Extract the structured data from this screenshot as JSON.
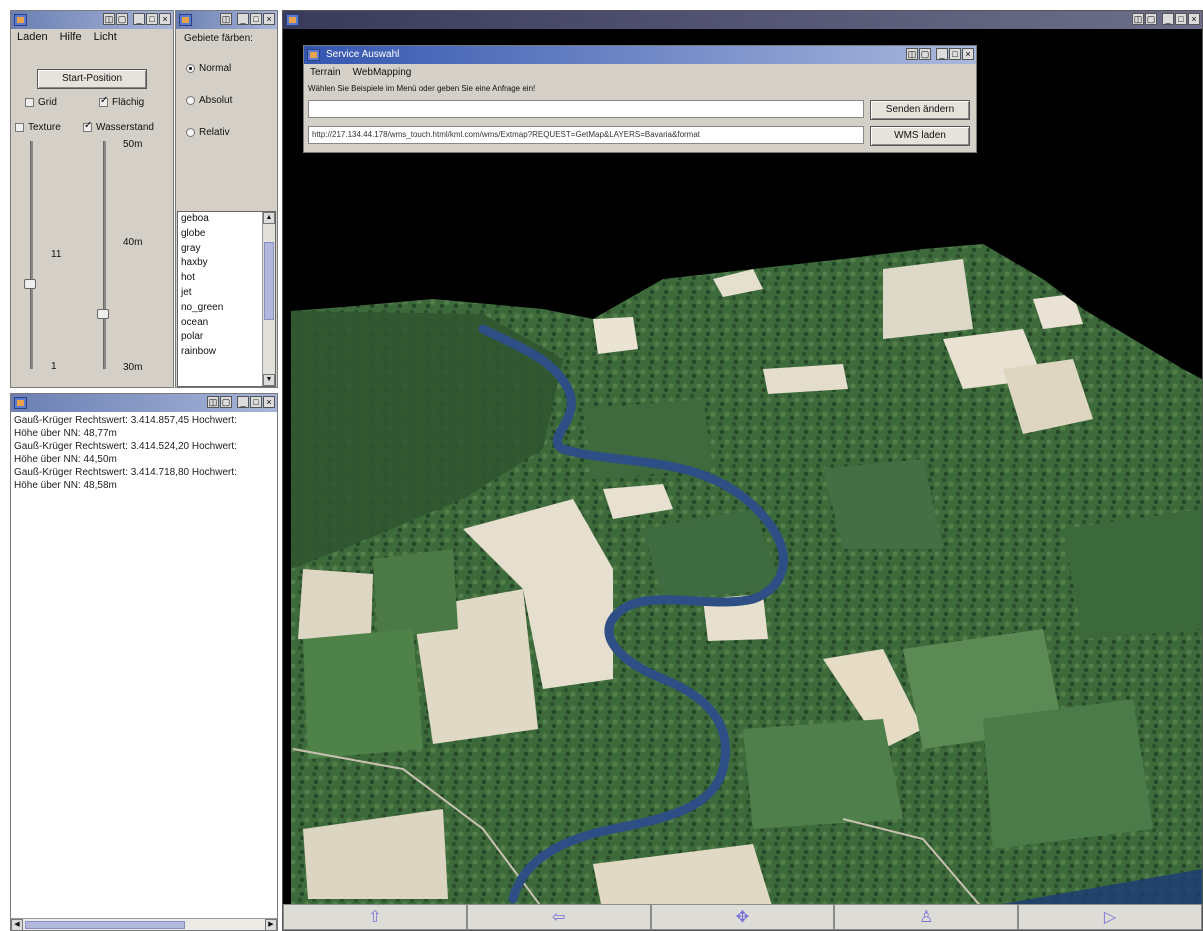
{
  "settings_window": {
    "title": "",
    "menu": [
      "Laden",
      "Hilfe",
      "Licht"
    ],
    "start_button": "Start-Position",
    "grid_label": "Grid",
    "drawing_label": "Flächig",
    "texture_label": "Texture",
    "water_label": "Wasserstand",
    "slider1_max": "",
    "slider1_mid": "11",
    "slider1_min": "1",
    "slider2_max": "50m",
    "slider2_mid": "40m",
    "slider2_min": "30m"
  },
  "coloring_window": {
    "title": "",
    "heading": "Gebiete färben:",
    "radio_normal": "Normal",
    "radio_absolut": "Absolut",
    "radio_relativ": "Relativ",
    "palettes": [
      "geboa",
      "globe",
      "gray",
      "haxby",
      "hot",
      "jet",
      "no_green",
      "ocean",
      "polar",
      "rainbow"
    ]
  },
  "log_window": {
    "title": "",
    "lines": [
      "Gauß-Krüger Rechtswert: 3.414.857,45 Hochwert:",
      "Höhe über NN: 48,77m",
      "Gauß-Krüger Rechtswert: 3.414.524,20 Hochwert:",
      "Höhe über NN: 44,50m",
      "Gauß-Krüger Rechtswert: 3.414.718,80 Hochwert:",
      "Höhe über NN: 48,58m"
    ]
  },
  "viewer_window": {
    "title": "",
    "nav_icons": [
      "forward-arrow-icon",
      "left-arrow-icon",
      "move-cross-icon",
      "person-up-icon",
      "right-arrow-icon"
    ]
  },
  "service_dialog": {
    "title": "Service Auswahl",
    "menu": [
      "Terrain",
      "WebMapping"
    ],
    "instruction": "Wählen Sie Beispiele im Menü oder geben Sie eine Anfrage ein!",
    "query_value": "",
    "url_value": "http://217.134.44.178/wms_touch.html/kml.com/wms/Extmap?REQUEST=GetMap&LAYERS=Bavaria&format",
    "send_button": "Senden ändern",
    "wms_button": "WMS laden"
  },
  "colors": {
    "river": "#2d4f86",
    "titlebar": "#6b7fb3",
    "scroll_thumb": "#b2b7dd"
  }
}
